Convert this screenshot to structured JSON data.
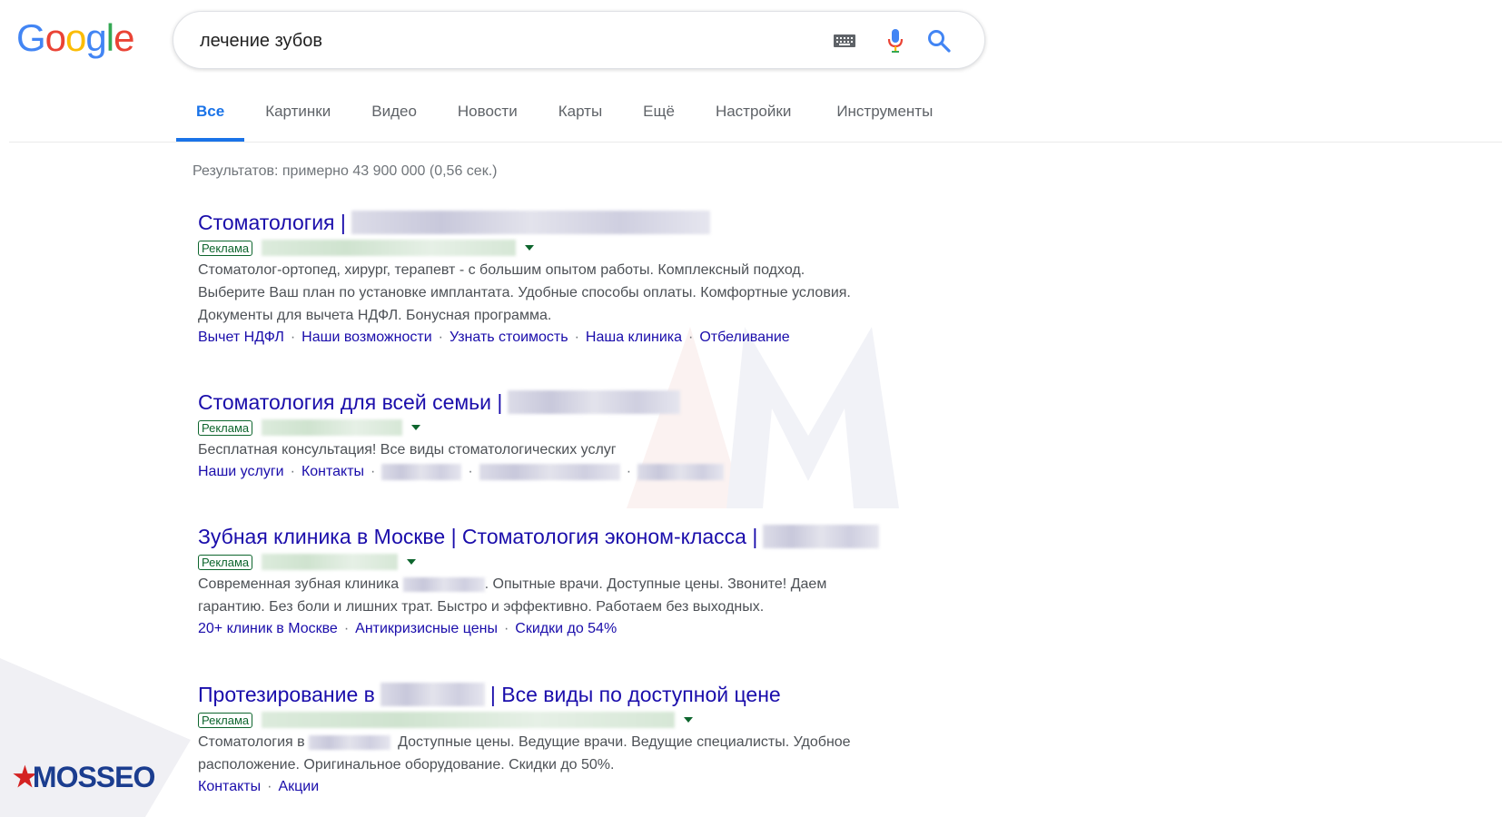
{
  "header": {
    "logo": "Google",
    "query": "лечение зубов"
  },
  "tabs": [
    {
      "label": "Все",
      "active": true
    },
    {
      "label": "Картинки"
    },
    {
      "label": "Видео"
    },
    {
      "label": "Новости"
    },
    {
      "label": "Карты"
    },
    {
      "label": "Ещё"
    },
    {
      "label": "Настройки"
    },
    {
      "label": "Инструменты"
    }
  ],
  "stats": "Результатов: примерно 43 900 000 (0,56 сек.)",
  "ad_label": "Реклама",
  "results": [
    {
      "title": "Стоматология |",
      "desc_lines": [
        "Стоматолог-ортопед, хирург, терапевт - с большим опытом работы. Комплексный подход.",
        "Выберите Ваш план по установке имплантата. Удобные способы оплаты. Комфортные условия.",
        "Документы для вычета НДФЛ. Бонусная программа."
      ],
      "links": [
        "Вычет НДФЛ",
        "Наши возможности",
        "Узнать стоимость",
        "Наша клиника",
        "Отбеливание"
      ]
    },
    {
      "title": "Стоматология для всей семьи |",
      "desc_lines": [
        "Бесплатная консультация! Все виды стоматологических услуг"
      ],
      "links": [
        "Наши услуги",
        "Контакты"
      ]
    },
    {
      "title": "Зубная клиника в Москве | Стоматология эконом-класса |",
      "desc_pre": "Современная зубная клиника",
      "desc_post": ". Опытные врачи. Доступные цены. Звоните! Даем",
      "desc_line2": "гарантию. Без боли и лишних трат. Быстро и эффективно. Работаем без выходных.",
      "links": [
        "20+ клиник в Москве",
        "Антикризисные цены",
        "Скидки до 54%"
      ]
    },
    {
      "title_pre": "Протезирование в",
      "title_post": "| Все виды по доступной цене",
      "desc_pre": "Стоматология в",
      "desc_post": "Доступные цены. Ведущие врачи. Ведущие специалисты. Удобное",
      "desc_line2": "расположение. Оригинальное оборудование. Скидки до 50%.",
      "links": [
        "Контакты",
        "Акции"
      ]
    }
  ],
  "watermark": "MOSSEO",
  "colors": {
    "link": "#1a0dab",
    "accent": "#1a73e8",
    "ad": "#0d652d",
    "text": "#4d5156",
    "muted": "#70757a"
  }
}
